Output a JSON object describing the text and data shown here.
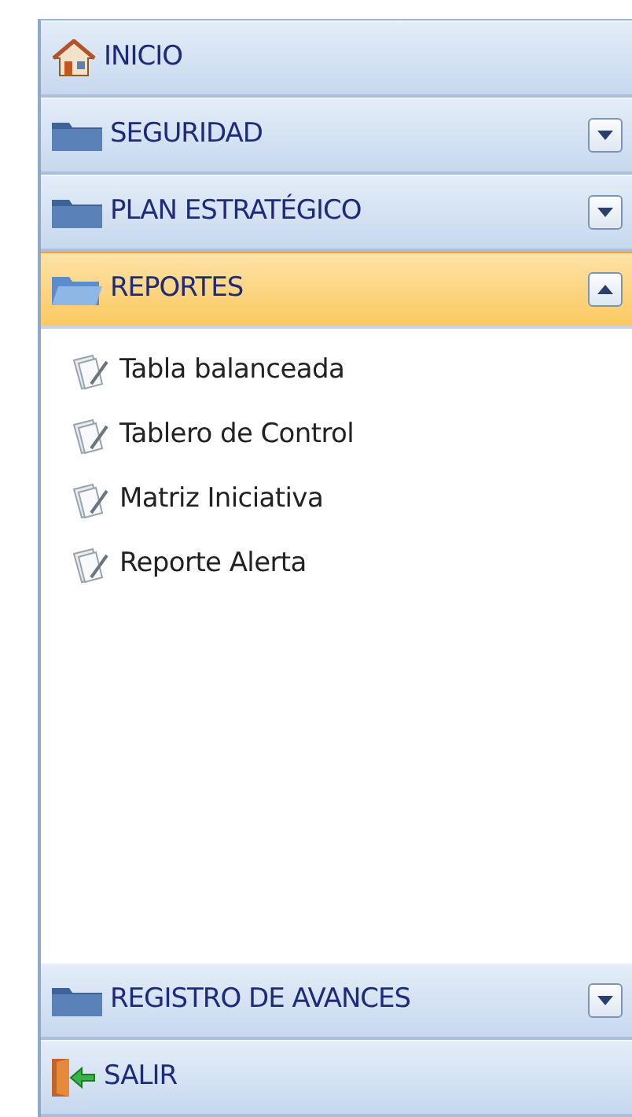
{
  "menu": [
    {
      "kind": "home",
      "label": "INICIO"
    },
    {
      "kind": "group",
      "label": "SEGURIDAD",
      "expanded": false
    },
    {
      "kind": "group",
      "label": "PLAN ESTRATÉGICO",
      "expanded": false
    },
    {
      "kind": "group",
      "label": "REPORTES",
      "expanded": true,
      "children": [
        {
          "label": "Tabla balanceada"
        },
        {
          "label": "Tablero de Control"
        },
        {
          "label": "Matriz Iniciativa"
        },
        {
          "label": "Reporte Alerta"
        }
      ]
    },
    {
      "kind": "group",
      "label": "REGISTRO DE AVANCES",
      "expanded": false
    },
    {
      "kind": "exit",
      "label": "SALIR"
    }
  ]
}
